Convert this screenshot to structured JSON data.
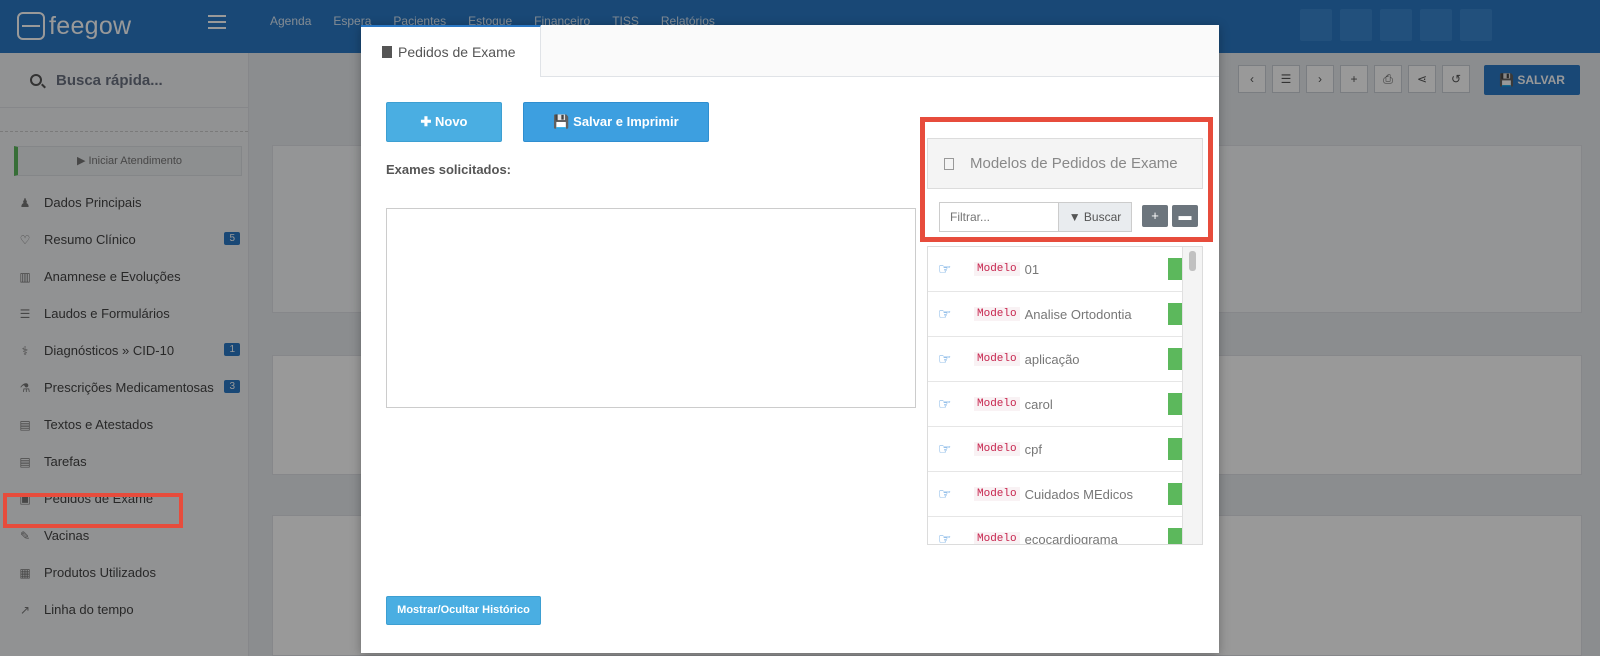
{
  "app": {
    "logo_text": "feegow",
    "topnav": [
      "Agenda",
      "Espera",
      "Pacientes",
      "Estoque",
      "Financeiro",
      "TISS",
      "Relatórios"
    ]
  },
  "sidebar": {
    "search_label": "Busca rápida...",
    "iniciar_label": "▶ Iniciar Atendimento",
    "items": [
      {
        "label": "Dados Principais",
        "icon": "user-icon",
        "glyph": "♟"
      },
      {
        "label": "Resumo Clínico",
        "icon": "heart-icon",
        "glyph": "♡",
        "badge": "5"
      },
      {
        "label": "Anamnese e Evoluções",
        "icon": "bar-chart-icon",
        "glyph": "▥"
      },
      {
        "label": "Laudos e Formulários",
        "icon": "list-icon",
        "glyph": "☰"
      },
      {
        "label": "Diagnósticos » CID-10",
        "icon": "stethoscope-icon",
        "glyph": "⚕",
        "badge": "1"
      },
      {
        "label": "Prescrições Medicamentosas",
        "icon": "flask-icon",
        "glyph": "⚗",
        "badge": "3"
      },
      {
        "label": "Textos e Atestados",
        "icon": "file-icon",
        "glyph": "▤"
      },
      {
        "label": "Tarefas",
        "icon": "file-icon",
        "glyph": "▤"
      },
      {
        "label": "Pedidos de Exame",
        "icon": "clipboard-icon",
        "glyph": "▣"
      },
      {
        "label": "Vacinas",
        "icon": "pin-icon",
        "glyph": "✎"
      },
      {
        "label": "Produtos Utilizados",
        "icon": "medkit-icon",
        "glyph": "▦"
      },
      {
        "label": "Linha do tempo",
        "icon": "line-chart-icon",
        "glyph": "↗"
      }
    ]
  },
  "toolbar": {
    "salvar_label": "💾 SALVAR"
  },
  "modal": {
    "tab_label": "Pedidos de Exame",
    "novo_label": "✚ Novo",
    "salvar_imprimir_label": "💾 Salvar e Imprimir",
    "exames_label": "Exames solicitados:",
    "historico_label": "Mostrar/Ocultar Histórico",
    "models": {
      "title": "Modelos de Pedidos de Exame",
      "filter_placeholder": "Filtrar...",
      "buscar_label": "▼ Buscar",
      "tag": "Modelo",
      "items": [
        "01",
        "Analise Ortodontia",
        "aplicação",
        "carol",
        "cpf",
        "Cuidados MEdicos",
        "ecocardiograma"
      ]
    }
  }
}
